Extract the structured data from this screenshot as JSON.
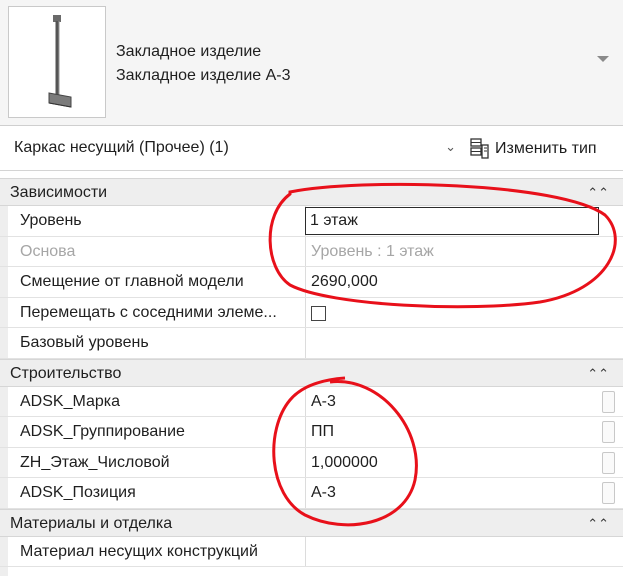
{
  "type_selector": {
    "family": "Закладное изделие",
    "type": "Закладное изделие А-3"
  },
  "instance_filter": {
    "label": "Каркас несущий (Прочее) (1)"
  },
  "edit_type_button": {
    "label": "Изменить тип"
  },
  "groups": [
    {
      "title": "Зависимости",
      "rows": [
        {
          "name": "Уровень",
          "value": "1 этаж"
        },
        {
          "name": "Основа",
          "value": "Уровень : 1 этаж"
        },
        {
          "name": "Смещение от главной модели",
          "value": "2690,000"
        },
        {
          "name": "Перемещать с соседними элеме...",
          "value": ""
        },
        {
          "name": "Базовый уровень",
          "value": ""
        }
      ]
    },
    {
      "title": "Строительство",
      "rows": [
        {
          "name": "ADSK_Марка",
          "value": "А-3"
        },
        {
          "name": "ADSK_Группирование",
          "value": "ПП"
        },
        {
          "name": "ZH_Этаж_Числовой",
          "value": "1,000000"
        },
        {
          "name": "ADSK_Позиция",
          "value": "А-3"
        }
      ]
    },
    {
      "title": "Материалы и отделка",
      "rows": [
        {
          "name": "Материал несущих конструкций",
          "value": ""
        }
      ]
    }
  ],
  "colors": {
    "annotation": "#e8101a",
    "group_header": "#eeeeee",
    "disabled_text": "#a6a6a6"
  },
  "icons": {
    "type_preview": "embedded-part-thumbnail",
    "edit_type": "edit-type-icon",
    "filter_dropdown": "chevron-down-icon",
    "type_dropdown": "dropdown-triangle-icon",
    "group_collapse": "double-chevron-up-icon"
  }
}
